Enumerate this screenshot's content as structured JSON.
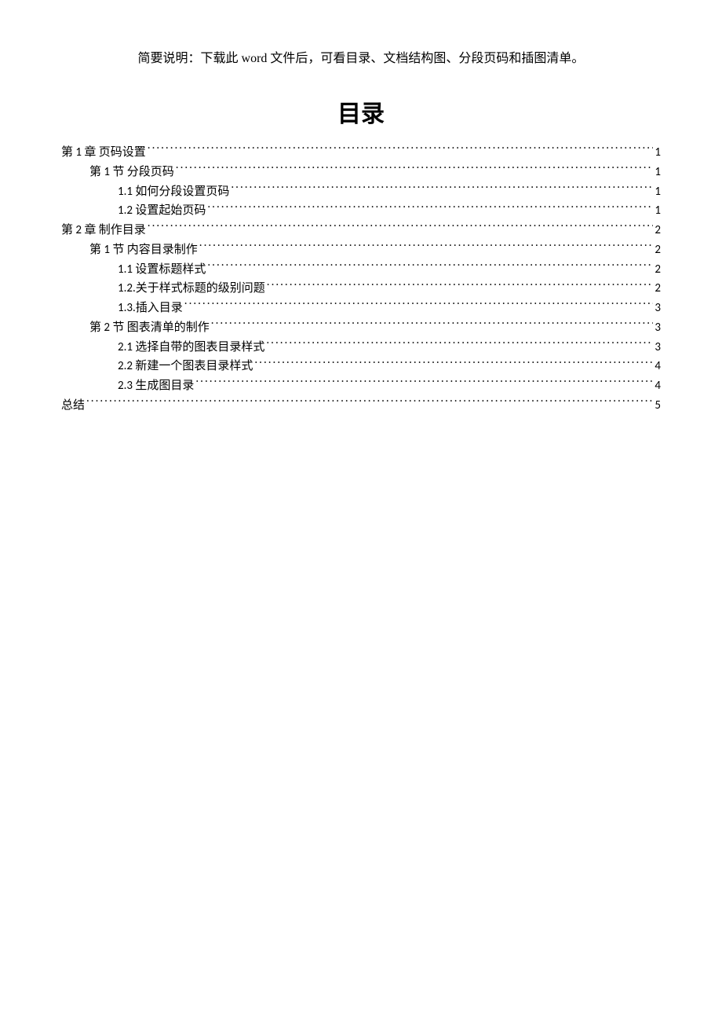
{
  "note": "简要说明：下载此 word 文件后，可看目录、文档结构图、分段页码和插图清单。",
  "title": "目录",
  "toc": [
    {
      "level": 0,
      "label": "第 1 章   页码设置",
      "page": "1"
    },
    {
      "level": 1,
      "label": "第 1 节  分段页码",
      "page": "1"
    },
    {
      "level": 2,
      "label": "1.1 如何分段设置页码",
      "page": "1"
    },
    {
      "level": 2,
      "label": "1.2  设置起始页码",
      "page": "1"
    },
    {
      "level": 0,
      "label": "第 2 章  制作目录",
      "page": "2"
    },
    {
      "level": 1,
      "label": "第 1 节  内容目录制作",
      "page": "2"
    },
    {
      "level": 2,
      "label": "1.1 设置标题样式",
      "page": "2"
    },
    {
      "level": 2,
      "label": "1.2.关于样式标题的级别问题",
      "page": "2"
    },
    {
      "level": 2,
      "label": "1.3.插入目录",
      "page": "3"
    },
    {
      "level": 1,
      "label": "第 2 节  图表清单的制作",
      "page": "3"
    },
    {
      "level": 2,
      "label": "2.1  选择自带的图表目录样式",
      "page": "3"
    },
    {
      "level": 2,
      "label": "2.2 新建一个图表目录样式",
      "page": "4"
    },
    {
      "level": 2,
      "label": "2.3 生成图目录",
      "page": "4"
    },
    {
      "level": 0,
      "label": "总结",
      "page": "5"
    }
  ]
}
